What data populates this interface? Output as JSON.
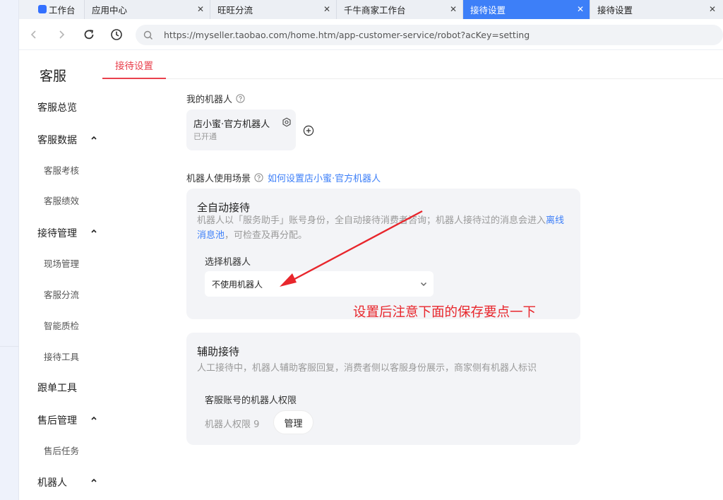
{
  "tabs": [
    {
      "label": "工作台",
      "closable": false
    },
    {
      "label": "应用中心",
      "closable": true
    },
    {
      "label": "旺旺分流",
      "closable": true
    },
    {
      "label": "千牛商家工作台",
      "closable": true
    },
    {
      "label": "接待设置",
      "closable": true,
      "active": true
    },
    {
      "label": "接待设置",
      "closable": true
    }
  ],
  "address": {
    "url": "https://myseller.taobao.com/home.htm/app-customer-service/robot?acKey=setting"
  },
  "sidebar": {
    "title": "客服",
    "items": [
      {
        "label": "客服总览",
        "level": 1
      },
      {
        "label": "客服数据",
        "level": 1,
        "expanded": true
      },
      {
        "label": "客服考核",
        "level": 2
      },
      {
        "label": "客服绩效",
        "level": 2
      },
      {
        "label": "接待管理",
        "level": 1,
        "expanded": true
      },
      {
        "label": "现场管理",
        "level": 2
      },
      {
        "label": "客服分流",
        "level": 2
      },
      {
        "label": "智能质检",
        "level": 2
      },
      {
        "label": "接待工具",
        "level": 2
      },
      {
        "label": "跟单工具",
        "level": 1
      },
      {
        "label": "售后管理",
        "level": 1,
        "expanded": true
      },
      {
        "label": "售后任务",
        "level": 2
      },
      {
        "label": "机器人",
        "level": 1,
        "expanded": true
      }
    ]
  },
  "page_tabs": [
    {
      "label": "接待设置",
      "active": true
    }
  ],
  "my_robot": {
    "section_label": "我的机器人",
    "robot_name": "店小蜜·官方机器人",
    "robot_status": "已开通"
  },
  "scenario": {
    "section_label": "机器人使用场景",
    "help_link": "如何设置店小蜜·官方机器人"
  },
  "auto_reception": {
    "title": "全自动接待",
    "desc_before": "机器人以「服务助手」账号身份，全自动接待消费者咨询；机器人接待过的消息会进入",
    "desc_link": "离线消息池",
    "desc_after": "，可检查及再分配。",
    "field_label": "选择机器人",
    "select_value": "不使用机器人"
  },
  "assist_reception": {
    "title": "辅助接待",
    "desc": "人工接待中，机器人辅助客服回复，消费者侧以客服身份展示，商家侧有机器人标识",
    "perm_title": "客服账号的机器人权限",
    "perm_label": "机器人权限 9",
    "manage_label": "管理"
  },
  "annotation": {
    "text": "设置后注意下面的保存要点一下"
  },
  "colors": {
    "accent": "#e9414d",
    "tab_active": "#3d7ff8",
    "link": "#3d7ff8",
    "annotation": "#e8262c"
  }
}
